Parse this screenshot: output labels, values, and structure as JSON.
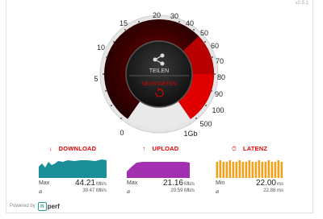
{
  "version": "v2.5.1",
  "gauge": {
    "scale_labels": [
      "0",
      "5",
      "10",
      "15",
      "20",
      "30",
      "40",
      "50",
      "60",
      "70",
      "80",
      "90",
      "100",
      "500",
      "1Gb"
    ],
    "share_label": "TEILEN",
    "restart_label": "NEUSTARTEN"
  },
  "colors": {
    "accent": "#e60000",
    "download": "#1b8f97",
    "upload": "#a12fb0",
    "latency": "#f0a21a"
  },
  "metrics": {
    "download": {
      "title": "DOWNLOAD",
      "icon": "arrow-down-icon",
      "value_label": "Max",
      "value": "44.21",
      "unit": "Mb/s",
      "sub_value": "39.47 Mb/s"
    },
    "upload": {
      "title": "UPLOAD",
      "icon": "arrow-up-icon",
      "value_label": "Max",
      "value": "21.16",
      "unit": "Mb/s",
      "sub_value": "20.59 Mb/s"
    },
    "latency": {
      "title": "LATENZ",
      "icon": "stopwatch-icon",
      "value_label": "Min",
      "value": "22.00",
      "unit": "ms",
      "sub_value": "22.88 ms"
    }
  },
  "footer": {
    "powered_by": "Powered by",
    "brand": "perf"
  }
}
